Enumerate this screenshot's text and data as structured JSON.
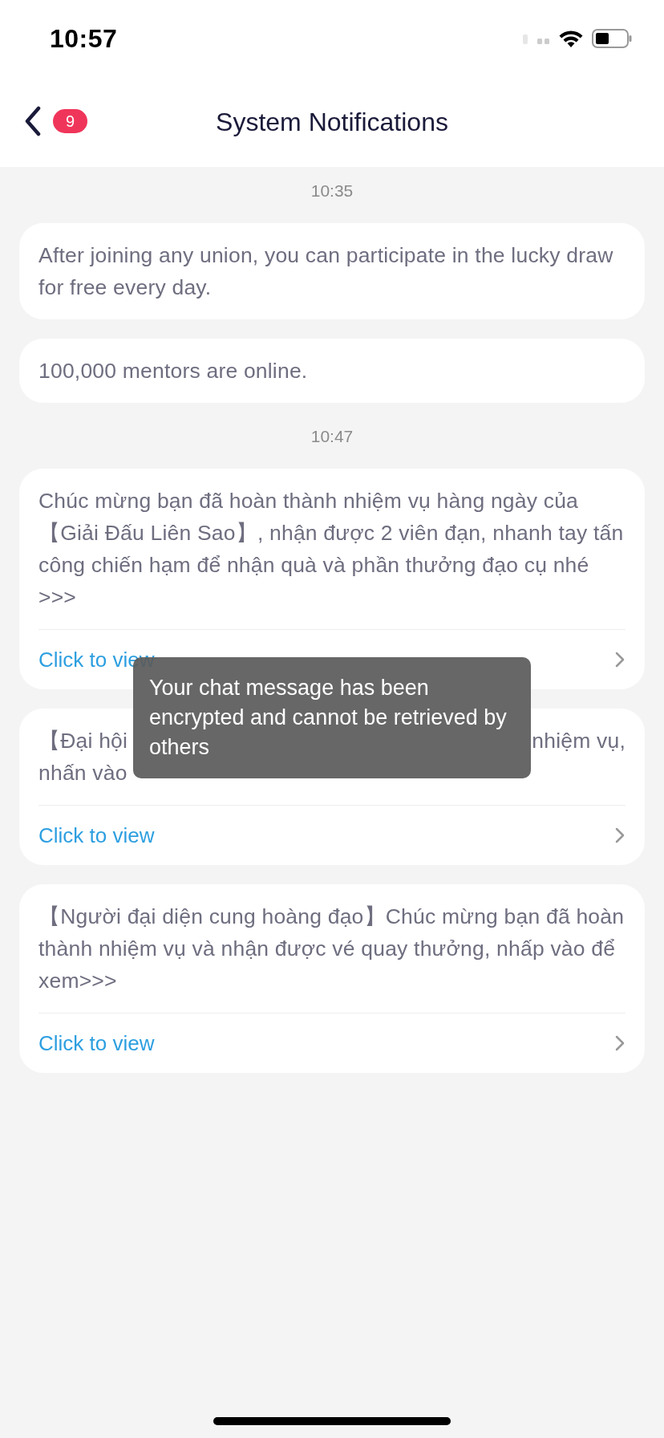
{
  "status_bar": {
    "time": "10:57"
  },
  "header": {
    "title": "System Notifications",
    "badge": "9"
  },
  "messages": [
    {
      "kind": "time",
      "text": "10:35"
    },
    {
      "kind": "notice",
      "text": "After joining any union, you can participate in the lucky draw for free every day."
    },
    {
      "kind": "notice",
      "text": "100,000 mentors are online."
    },
    {
      "kind": "time",
      "text": "10:47"
    },
    {
      "kind": "action",
      "text": "Chúc mừng bạn đã hoàn thành nhiệm vụ hàng ngày của【Giải Đấu Liên Sao】, nhận được 2 viên đạn, nhanh tay tấn công chiến hạm để nhận quà và phần thưởng đạo cụ nhé >>>",
      "link": "Click to view"
    },
    {
      "kind": "covered",
      "lines": [
        {
          "left": "【Đại hội",
          "right": "nhiệm vụ,"
        },
        {
          "left": "nhấn vào"
        }
      ],
      "link": "Click to view"
    },
    {
      "kind": "action",
      "text": "【Người đại diện cung hoàng đạo】Chúc mừng bạn đã hoàn thành nhiệm vụ và nhận được vé quay thưởng, nhấp vào để xem>>>",
      "link": "Click to view"
    }
  ],
  "toast": {
    "text": "Your chat message has been encrypted and cannot be retrieved by others"
  }
}
